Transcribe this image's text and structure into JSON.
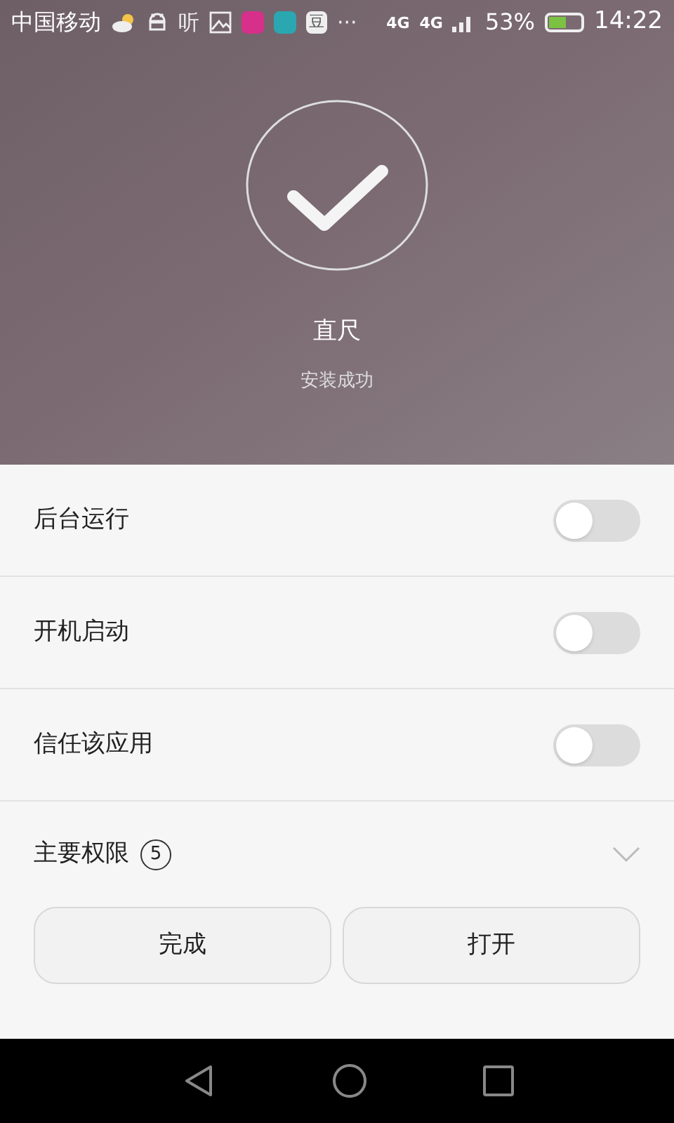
{
  "status_bar": {
    "carrier": "中国移动",
    "notifications": [
      {
        "kind": "weather"
      },
      {
        "kind": "android"
      },
      {
        "kind": "glyph",
        "text": "听"
      },
      {
        "kind": "image"
      },
      {
        "kind": "app",
        "color": "#d6308a"
      },
      {
        "kind": "app",
        "color": "#2aa7b0"
      },
      {
        "kind": "boxed",
        "text": "豆"
      },
      {
        "kind": "glyph",
        "text": "···"
      }
    ],
    "network": [
      "4G",
      "4G"
    ],
    "battery": {
      "reading": "53%"
    },
    "time": "14:22"
  },
  "result": {
    "app_name": "直尺",
    "message": "安装成功"
  },
  "settings": [
    {
      "label": "后台运行",
      "on": false
    },
    {
      "label": "开机启动",
      "on": false
    },
    {
      "label": "信任该应用",
      "on": false
    }
  ],
  "permissions": {
    "label": "主要权限",
    "count": "5",
    "expanded": false
  },
  "buttons": [
    "完成",
    "打开"
  ]
}
